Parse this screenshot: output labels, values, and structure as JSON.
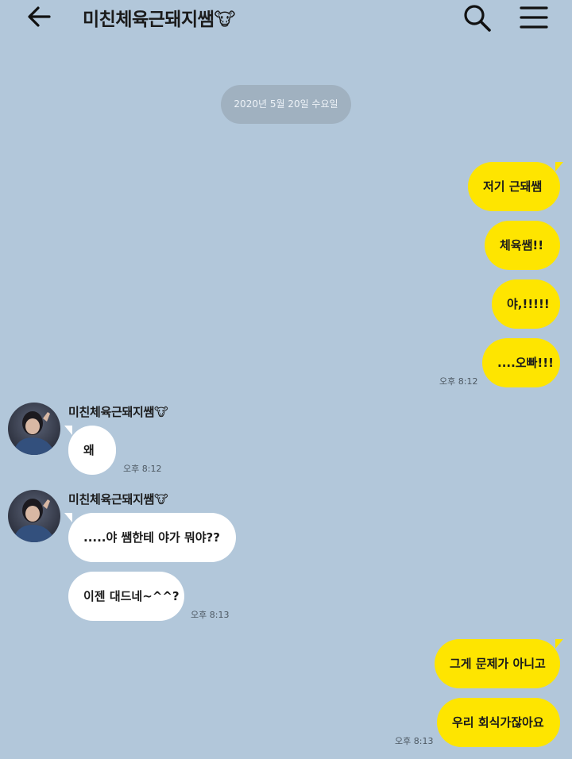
{
  "header": {
    "title": "미친체육근돼지쌤🐮"
  },
  "date_divider": "2020년 5월 20일 수요일",
  "messages": {
    "me1": "저기 근돼쌤",
    "me2": "체육쌤!!",
    "me3": "야,!!!!!",
    "me4": "....오빠!!!",
    "them1": "왜",
    "them2": ".....야 쌤한테 야가 뭐야??",
    "them3": "이젠 대드네~^^?",
    "me5": "그게 문제가 아니고",
    "me6": "우리 회식가잖아요"
  },
  "times": {
    "t1": "오후 8:12",
    "t2": "오후 8:12",
    "t3": "오후 8:13",
    "t4": "오후 8:13"
  },
  "senders": {
    "s1": "미친체육근돼지쌤🐮",
    "s2": "미친체육근돼지쌤🐮"
  },
  "colors": {
    "background": "#b2c7da",
    "my_bubble": "#fee500",
    "their_bubble": "#ffffff"
  },
  "icons": {
    "back": "back-arrow-icon",
    "search": "search-icon",
    "menu": "hamburger-menu-icon",
    "emoji": "pig-face-emoji"
  }
}
